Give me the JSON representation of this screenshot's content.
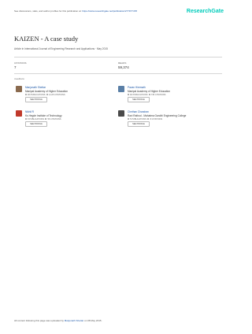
{
  "header": {
    "note_prefix": "See discussions, stats, and author profiles for this publication at:",
    "note_url": "https://www.researchgate.net/publication/277977478",
    "logo": "ResearchGate"
  },
  "paper": {
    "title": "KAIZEN - A case study",
    "venue": "Article in International Journal of Engineering Research and Applications · May 2015"
  },
  "stats": {
    "citations_label": "CITATIONS",
    "citations_value": "7",
    "reads_label": "READS",
    "reads_value": "59,374"
  },
  "authors_label": "4 authors:",
  "authors": [
    {
      "name": "Manjunath Shettar",
      "affiliation": "Manipal Academy of Higher Education",
      "publications": "96 PUBLICATIONS",
      "citations": "2,125 CITATIONS",
      "button": "SEE PROFILE",
      "avatar_color": "#8a6a4e"
    },
    {
      "name": "Pavan Hiremath",
      "affiliation": "Manipal Academy of Higher Education",
      "publications": "92 PUBLICATIONS",
      "citations": "735 CITATIONS",
      "button": "SEE PROFILE",
      "avatar_color": "#5a7fa6"
    },
    {
      "name": "Nikhil R",
      "affiliation": "Ks Hegde Institute of Technology",
      "publications": "8 PUBLICATIONS",
      "citations": "56 CITATIONS",
      "button": "SEE PROFILE",
      "avatar_color": "#c0392b"
    },
    {
      "name": "Chethan Chandran",
      "affiliation": "Ravi Rathod - Mahatma Gandhi Engineering College",
      "publications": "5 PUBLICATIONS",
      "citations": "8 CITATIONS",
      "button": "SEE PROFILE",
      "avatar_color": "#4a4a4a"
    }
  ],
  "footer": {
    "prefix": "All content following this page was uploaded by",
    "uploader": "Manjunath Shettar",
    "suffix": "on 08 May 2015."
  }
}
